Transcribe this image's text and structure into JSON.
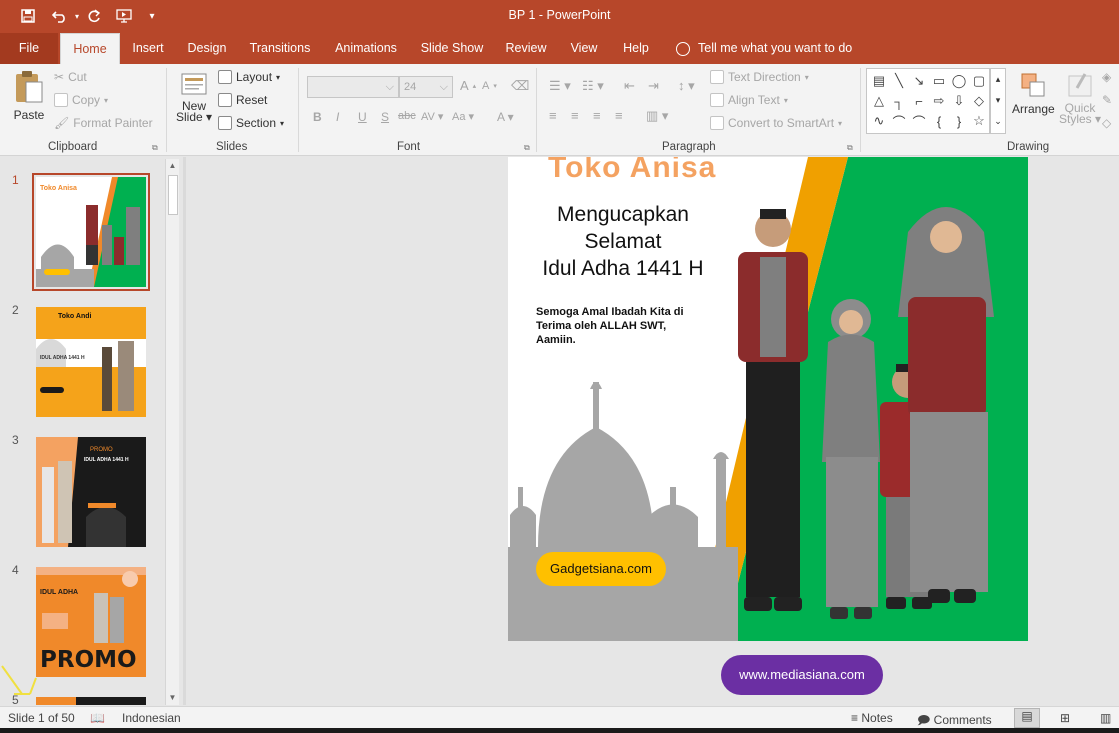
{
  "window": {
    "title": "BP 1  -  PowerPoint"
  },
  "quick_access": {
    "icons": [
      "save-icon",
      "undo-icon",
      "redo-icon",
      "start-from-beginning-icon",
      "customize-icon"
    ]
  },
  "tabs": [
    {
      "label": "File"
    },
    {
      "label": "Home"
    },
    {
      "label": "Insert"
    },
    {
      "label": "Design"
    },
    {
      "label": "Transitions"
    },
    {
      "label": "Animations"
    },
    {
      "label": "Slide Show"
    },
    {
      "label": "Review"
    },
    {
      "label": "View"
    },
    {
      "label": "Help"
    }
  ],
  "tell_me": "Tell me what you want to do",
  "ribbon": {
    "clipboard": {
      "paste": "Paste",
      "cut": "Cut",
      "copy": "Copy",
      "format_painter": "Format Painter",
      "label": "Clipboard"
    },
    "slides": {
      "new_slide_1": "New",
      "new_slide_2": "Slide",
      "layout": "Layout",
      "reset": "Reset",
      "section": "Section",
      "label": "Slides"
    },
    "font": {
      "size": "24",
      "label": "Font"
    },
    "paragraph": {
      "text_direction": "Text Direction",
      "align_text": "Align Text",
      "smartart": "Convert to SmartArt",
      "label": "Paragraph"
    },
    "drawing": {
      "arrange": "Arrange",
      "quick_1": "Quick",
      "quick_2": "Styles",
      "label": "Drawing"
    }
  },
  "thumbnails": [
    {
      "num": "1",
      "shop": "Toko Anisa"
    },
    {
      "num": "2",
      "shop": "Toko Andi",
      "line": "IDUL ADHA 1441 H"
    },
    {
      "num": "3",
      "shop": "PROMO",
      "line": "IDUL ADHA 1441 H"
    },
    {
      "num": "4",
      "shop": "IDUL ADHA",
      "line": "PROMO"
    },
    {
      "num": "5"
    }
  ],
  "slide": {
    "shop_name": "Toko Anisa",
    "greeting_1": "Mengucapkan",
    "greeting_2": "Selamat",
    "greeting_3": "Idul Adha 1441 H",
    "message": "Semoga Amal Ibadah Kita di Terima oleh ALLAH SWT, Aamiin.",
    "button": "Gadgetsiana.com"
  },
  "watermark": "www.mediasiana.com",
  "status": {
    "slide_count": "Slide 1 of 50",
    "language": "Indonesian",
    "notes": "Notes",
    "comments": "Comments"
  },
  "colors": {
    "accent": "#b7472a",
    "slide_orange": "#f0892a",
    "slide_green": "#00b050",
    "button_yellow": "#ffc000",
    "watermark_purple": "#6b2fa3"
  }
}
